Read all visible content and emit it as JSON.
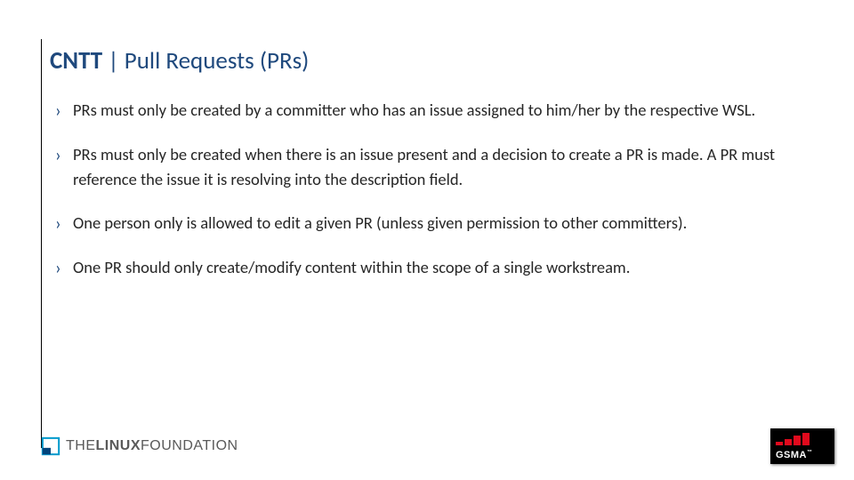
{
  "slide": {
    "title_bold": "CNTT",
    "title_sep": " | ",
    "title_rest": "Pull Requests (PRs)",
    "bullets": [
      "PRs must only be created by a committer who has an issue assigned to him/her by the respective WSL.",
      "PRs must only be created when there is an issue present and a decision to create a PR is made. A PR must reference the issue it is resolving into the description field.",
      "One person only is allowed to edit a given PR (unless given permission to other committers).",
      "One PR should only create/modify content within the scope of a single workstream."
    ]
  },
  "footer": {
    "linux_foundation": {
      "the": "THE",
      "linux": "LINUX",
      "foundation": "FOUNDATION"
    },
    "gsma": {
      "label": "GSMA",
      "tm": "™"
    }
  }
}
